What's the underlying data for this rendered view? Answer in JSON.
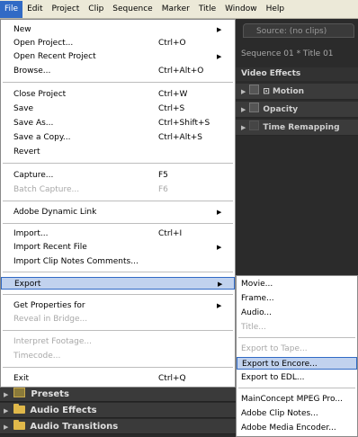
{
  "menubar": {
    "items": [
      "File",
      "Edit",
      "Project",
      "Clip",
      "Sequence",
      "Marker",
      "Title",
      "Window",
      "Help"
    ]
  },
  "right_panel": {
    "source_tab": "Source: (no clips)",
    "sequence_label": "Sequence 01 * Title 01",
    "video_effects": "Video Effects",
    "effects": [
      "Motion",
      "Opacity",
      "Time Remapping"
    ]
  },
  "project_panel": {
    "rows": [
      "Presets",
      "Audio Effects",
      "Audio Transitions"
    ]
  },
  "file_menu": {
    "new": {
      "label": "New"
    },
    "open_project": {
      "label": "Open Project...",
      "shortcut": "Ctrl+O"
    },
    "open_recent": {
      "label": "Open Recent Project"
    },
    "browse": {
      "label": "Browse...",
      "shortcut": "Ctrl+Alt+O"
    },
    "close_project": {
      "label": "Close Project",
      "shortcut": "Ctrl+W"
    },
    "save": {
      "label": "Save",
      "shortcut": "Ctrl+S"
    },
    "save_as": {
      "label": "Save As...",
      "shortcut": "Ctrl+Shift+S"
    },
    "save_copy": {
      "label": "Save a Copy...",
      "shortcut": "Ctrl+Alt+S"
    },
    "revert": {
      "label": "Revert"
    },
    "capture": {
      "label": "Capture...",
      "shortcut": "F5"
    },
    "batch_capture": {
      "label": "Batch Capture...",
      "shortcut": "F6"
    },
    "dynamic_link": {
      "label": "Adobe Dynamic Link"
    },
    "import": {
      "label": "Import...",
      "shortcut": "Ctrl+I"
    },
    "import_recent": {
      "label": "Import Recent File"
    },
    "import_clip_notes": {
      "label": "Import Clip Notes Comments..."
    },
    "export": {
      "label": "Export"
    },
    "get_properties": {
      "label": "Get Properties for"
    },
    "reveal_bridge": {
      "label": "Reveal in Bridge..."
    },
    "interpret_footage": {
      "label": "Interpret Footage..."
    },
    "timecode": {
      "label": "Timecode..."
    },
    "exit": {
      "label": "Exit",
      "shortcut": "Ctrl+Q"
    }
  },
  "export_menu": {
    "movie": "Movie...",
    "frame": "Frame...",
    "audio": "Audio...",
    "title": "Title...",
    "export_tape": "Export to Tape...",
    "export_encore": "Export to Encore...",
    "export_edl": "Export to EDL...",
    "mainconcept": "MainConcept MPEG Pro...",
    "clip_notes": "Adobe Clip Notes...",
    "media_encoder": "Adobe Media Encoder..."
  }
}
